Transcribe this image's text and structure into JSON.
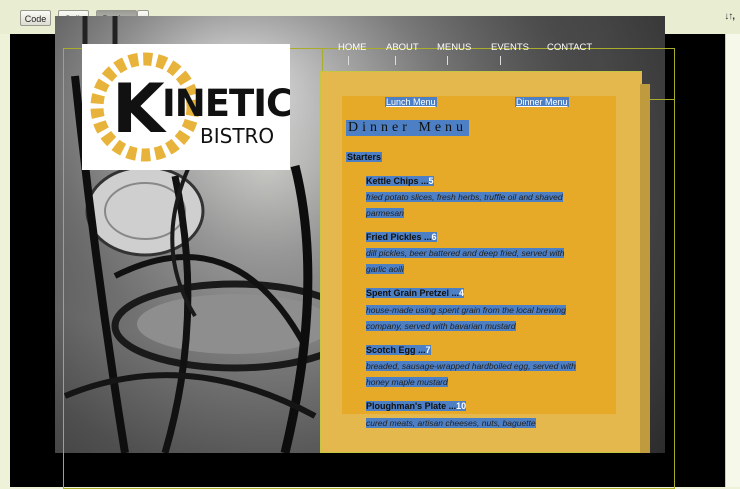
{
  "toolbar": {
    "code_label": "Code",
    "split_label": "Split",
    "design_label": "Design",
    "dropdown_icon": "chevron-down-icon",
    "sort_icon": "sort-icon"
  },
  "logo": {
    "brand": "KINETIC BISTRO"
  },
  "nav": [
    {
      "label": "HOME"
    },
    {
      "label": "ABOUT"
    },
    {
      "label": "MENUS"
    },
    {
      "label": "EVENTS"
    },
    {
      "label": "CONTACT"
    }
  ],
  "tabs": {
    "lunch": "Lunch Menu",
    "dinner": "Dinner Menu"
  },
  "menu": {
    "title": "Dinner Menu",
    "section": "Starters",
    "items": [
      {
        "name": "Kettle Chips ...",
        "price": "5",
        "desc1": "fried potato slices, fresh herbs, truffle oil and shaved",
        "desc2": "parmesan"
      },
      {
        "name": "Fried Pickles ...",
        "price": "6",
        "desc1": "dill pickles, beer battered and deep fried, served with",
        "desc2": "garlic aoili"
      },
      {
        "name": "Spent Grain Pretzel ...",
        "price": "4",
        "desc1": "house-made using spent grain from the local brewing",
        "desc2": "company, served with bavarian mustard"
      },
      {
        "name": "Scotch Egg ...",
        "price": "7",
        "desc1": "breaded, sausage-wrapped hardboiled egg, served with",
        "desc2": "honey maple mustard"
      },
      {
        "name": "Ploughman's Plate ...",
        "price": "10",
        "desc1": "cured meats, artisan cheeses, nuts, baguette"
      }
    ]
  },
  "colors": {
    "accent": "#e5b84e",
    "highlight": "#4d7fc4",
    "guide": "#a9ad2a"
  }
}
